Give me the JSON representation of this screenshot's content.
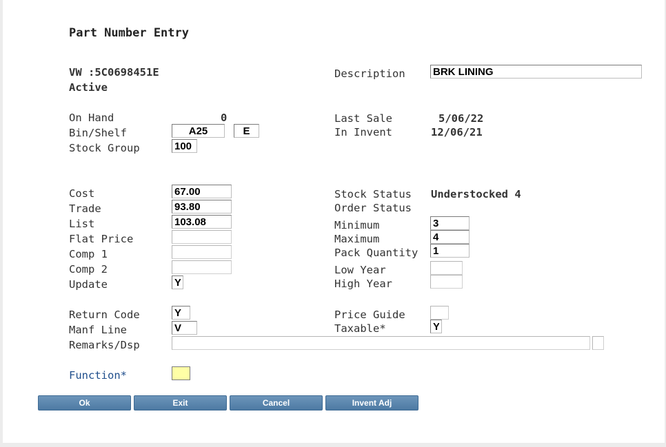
{
  "header": {
    "title": "Part Number Entry"
  },
  "part": {
    "number": "VW :5C0698451E",
    "state": "Active"
  },
  "labels": {
    "description": "Description",
    "on_hand": "On Hand",
    "bin_shelf": "Bin/Shelf",
    "stock_group": "Stock Group",
    "last_sale": "Last Sale",
    "in_invent": "In Invent",
    "cost": "Cost",
    "trade": "Trade",
    "list": "List",
    "flat_price": "Flat Price",
    "comp1": "Comp 1",
    "comp2": "Comp 2",
    "update": "Update",
    "stock_status": "Stock Status",
    "order_status": "Order Status",
    "minimum": "Minimum",
    "maximum": "Maximum",
    "pack_quantity": "Pack Quantity",
    "low_year": "Low Year",
    "high_year": "High Year",
    "return_code": "Return Code",
    "manf_line": "Manf Line",
    "remarks": "Remarks/Dsp",
    "price_guide": "Price Guide",
    "taxable": "Taxable*",
    "function": "Function*"
  },
  "values": {
    "description": "BRK LINING",
    "on_hand": "0",
    "bin": "A25",
    "shelf": "E",
    "stock_group": "100",
    "last_sale": "5/06/22",
    "in_invent": "12/06/21",
    "cost": "67.00",
    "trade": "93.80",
    "list": "103.08",
    "flat_price": "",
    "comp1": "",
    "comp2": "",
    "update": "Y",
    "stock_status": "Understocked 4",
    "order_status": "",
    "minimum": "3",
    "maximum": "4",
    "pack_quantity": "1",
    "low_year": "",
    "high_year": "",
    "return_code": "Y",
    "manf_line": "V",
    "remarks": "",
    "remarks_extra": "",
    "price_guide": "",
    "taxable": "Y",
    "function": ""
  },
  "buttons": {
    "ok": "Ok",
    "exit": "Exit",
    "cancel": "Cancel",
    "invent_adj": "Invent Adj"
  }
}
